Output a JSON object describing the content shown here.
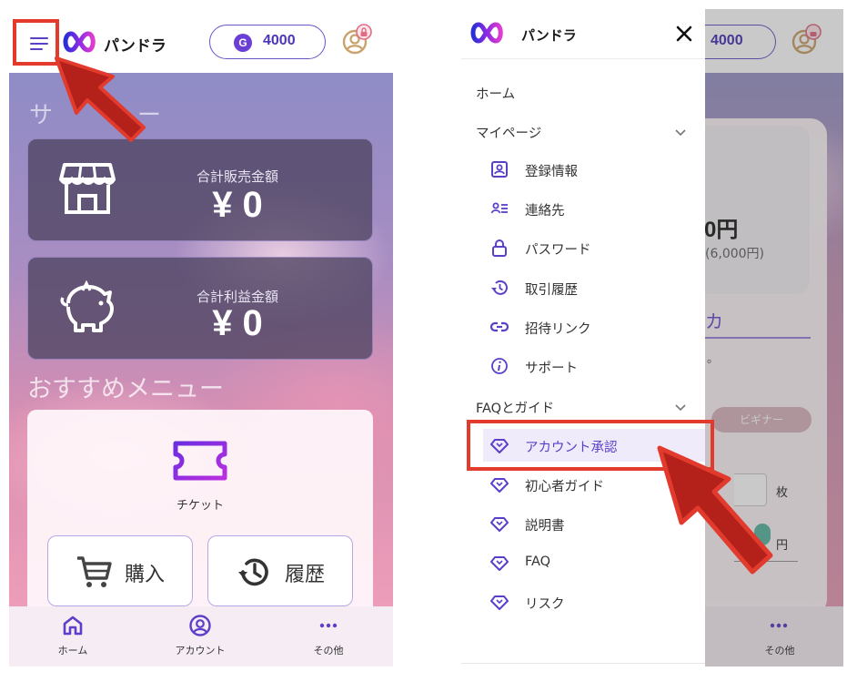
{
  "brand": {
    "name": "パンドラ"
  },
  "header": {
    "gem_letter": "G",
    "gem_balance": "4000"
  },
  "home": {
    "section_title_partial": "サ",
    "section_title_tail": "ー",
    "sales_label": "合計販売金額",
    "sales_value": "¥ 0",
    "profit_label": "合計利益金額",
    "profit_value": "¥ 0",
    "recommend_title": "おすすめメニュー",
    "ticket_label": "チケット",
    "buy_label": "購入",
    "history_label": "履歴"
  },
  "bottom_nav": [
    {
      "label": "ホーム",
      "icon": "home-icon"
    },
    {
      "label": "アカウント",
      "icon": "account-icon"
    },
    {
      "label": "その他",
      "icon": "more-icon"
    }
  ],
  "drawer": {
    "home": "ホーム",
    "mypage": "マイページ",
    "mypage_items": [
      {
        "label": "登録情報",
        "icon": "profile-icon"
      },
      {
        "label": "連絡先",
        "icon": "contact-icon"
      },
      {
        "label": "パスワード",
        "icon": "lock-icon"
      },
      {
        "label": "取引履歴",
        "icon": "history-icon"
      },
      {
        "label": "招待リンク",
        "icon": "link-icon"
      },
      {
        "label": "サポート",
        "icon": "info-icon"
      }
    ],
    "faq_guide": "FAQとガイド",
    "faq_items": [
      {
        "label": "アカウント承認",
        "icon": "diamond-icon",
        "active": true
      },
      {
        "label": "初心者ガイド",
        "icon": "diamond-icon"
      },
      {
        "label": "説明書",
        "icon": "diamond-icon"
      },
      {
        "label": "FAQ",
        "icon": "diamond-icon"
      },
      {
        "label": "リスク",
        "icon": "diamond-icon"
      }
    ]
  },
  "background_page": {
    "price_partial": "0円",
    "price_sub": "(6,000円)",
    "kana_partial": "カ",
    "dot_text": "。",
    "beginner_badge": "ビギナー",
    "unit_mai": "枚",
    "unit_yen": "円",
    "nav_more": "その他"
  },
  "colors": {
    "accent": "#5b3fc9",
    "highlight": "#e23b2e",
    "arrow": "#b3211a"
  }
}
